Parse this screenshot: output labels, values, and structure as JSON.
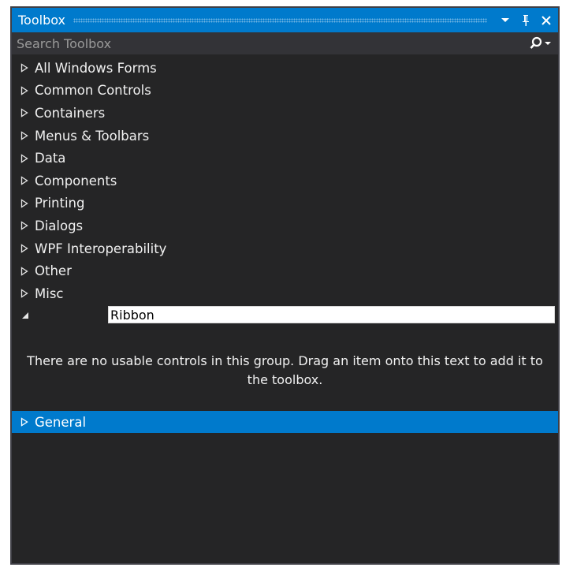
{
  "window": {
    "title": "Toolbox",
    "dropdown_icon": "chevron-down-icon",
    "pin_icon": "pin-icon",
    "close_icon": "close-icon",
    "accent_color": "#007acc"
  },
  "search": {
    "placeholder": "Search Toolbox",
    "icon": "search-icon"
  },
  "groups": [
    {
      "label": "All Windows Forms",
      "expanded": false
    },
    {
      "label": "Common Controls",
      "expanded": false
    },
    {
      "label": "Containers",
      "expanded": false
    },
    {
      "label": "Menus & Toolbars",
      "expanded": false
    },
    {
      "label": "Data",
      "expanded": false
    },
    {
      "label": "Components",
      "expanded": false
    },
    {
      "label": "Printing",
      "expanded": false
    },
    {
      "label": "Dialogs",
      "expanded": false
    },
    {
      "label": "WPF Interoperability",
      "expanded": false
    },
    {
      "label": "Other",
      "expanded": false
    },
    {
      "label": "Misc",
      "expanded": false
    }
  ],
  "editing_group": {
    "value": "Ribbon",
    "expanded": true,
    "empty_message": "There are no usable controls in this group. Drag an item onto this text to add it to the toolbox."
  },
  "selected_group": {
    "label": "General",
    "expanded": false
  }
}
